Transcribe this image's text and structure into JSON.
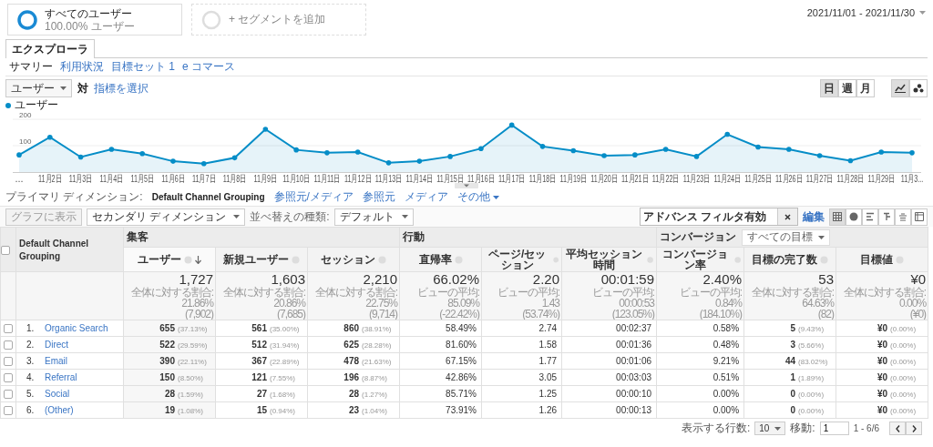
{
  "segments": [
    {
      "kind": "active",
      "title": "すべてのユーザー",
      "subtitle": "100.00% ユーザー"
    },
    {
      "kind": "add",
      "title": "+ セグメントを追加"
    }
  ],
  "date_range": "2021/11/01 - 2021/11/30",
  "tabs": [
    {
      "label": "エクスプローラ",
      "selected": true
    }
  ],
  "subtabs": [
    {
      "label": "サマリー",
      "selected": true
    },
    {
      "label": "利用状況",
      "selected": false
    },
    {
      "label": "目標セット 1",
      "selected": false
    },
    {
      "label": "e コマース",
      "selected": false
    }
  ],
  "metric_selector": {
    "metric": "ユーザー",
    "vs": "対",
    "compare_link": "指標を選択"
  },
  "interval_buttons": [
    {
      "label": "日",
      "selected": true
    },
    {
      "label": "週",
      "selected": false
    },
    {
      "label": "月",
      "selected": false
    }
  ],
  "chart_type_buttons": [
    {
      "kind": "line",
      "selected": true
    },
    {
      "kind": "motion",
      "selected": false
    }
  ],
  "chart": {
    "chart_data": {
      "type": "area",
      "categories": [
        "...",
        "11月2日",
        "11月3日",
        "11月4日",
        "11月5日",
        "11月6日",
        "11月7日",
        "11月8日",
        "11月9日",
        "11月10日",
        "11月11日",
        "11月12日",
        "11月13日",
        "11月14日",
        "11月15日",
        "11月16日",
        "11月17日",
        "11月18日",
        "11月19日",
        "11月20日",
        "11月21日",
        "11月22日",
        "11月23日",
        "11月24日",
        "11月25日",
        "11月26日",
        "11月27日",
        "11月28日",
        "11月29日",
        "11月3..."
      ],
      "series": [
        {
          "name": "ユーザー",
          "color": "#058dc7",
          "values": [
            65,
            132,
            57,
            86,
            70,
            41,
            32,
            54,
            162,
            84,
            73,
            76,
            35,
            41,
            59,
            89,
            178,
            97,
            81,
            62,
            65,
            86,
            59,
            143,
            95,
            86,
            62,
            43,
            76,
            73
          ]
        }
      ],
      "ylim": [
        0,
        200
      ],
      "yticks": [
        100,
        200
      ]
    }
  },
  "primary_dimension": {
    "label": "プライマリ ディメンション:",
    "options": [
      {
        "label": "Default Channel Grouping",
        "kind": "link",
        "selected": true
      },
      {
        "label": "参照元/メディア",
        "kind": "link",
        "selected": false
      },
      {
        "label": "参照元",
        "kind": "link",
        "selected": false
      },
      {
        "label": "メディア",
        "kind": "link",
        "selected": false
      },
      {
        "label": "その他",
        "kind": "menu",
        "selected": false
      }
    ]
  },
  "toolbar": {
    "plot_button": {
      "label": "グラフに表示",
      "disabled": true
    },
    "secondary_dimension": "セカンダリ ディメンション",
    "sort_label": "並べ替えの種類:",
    "sort_value": "デフォルト",
    "filter": "アドバンス フィルタ有効",
    "edit_link": "編集",
    "views": [
      {
        "kind": "table",
        "selected": true
      },
      {
        "kind": "pie",
        "selected": false
      },
      {
        "kind": "performance",
        "selected": false
      },
      {
        "kind": "comparison",
        "selected": false
      },
      {
        "kind": "term-cloud",
        "selected": false
      },
      {
        "kind": "pivot",
        "selected": false
      }
    ]
  },
  "table": {
    "select_all_checked": false,
    "dimension_header": "Default Channel Grouping",
    "groups": [
      {
        "label": "集客",
        "columns": [
          {
            "label": "ユーザー",
            "sorted": true
          },
          {
            "label": "新規ユーザー",
            "sorted": false
          },
          {
            "label": "セッション",
            "sorted": false
          }
        ]
      },
      {
        "label": "行動",
        "columns": [
          {
            "label": "直帰率",
            "sorted": false
          },
          {
            "label": "ページ/セッション",
            "sorted": false
          },
          {
            "label": "平均セッション時間",
            "sorted": false
          }
        ]
      },
      {
        "label": "コンバージョン",
        "goal_selector": "すべての目標",
        "columns": [
          {
            "label": "コンバージョン率",
            "sorted": false
          },
          {
            "label": "目標の完了数",
            "sorted": false
          },
          {
            "label": "目標値",
            "sorted": false
          }
        ]
      }
    ],
    "totals": [
      {
        "value": "1,727",
        "note": "全体に対する割合: 21.86%",
        "base": "(7,902)"
      },
      {
        "value": "1,603",
        "note": "全体に対する割合: 20.86%",
        "base": "(7,685)"
      },
      {
        "value": "2,210",
        "note": "全体に対する割合: 22.75%",
        "base": "(9,714)"
      },
      {
        "value": "66.02%",
        "note": "ビューの平均: 85.09%",
        "base": "(-22.42%)"
      },
      {
        "value": "2.20",
        "note": "ビューの平均: 1.43",
        "base": "(53.74%)"
      },
      {
        "value": "00:01:59",
        "note": "ビューの平均: 00:00:53",
        "base": "(123.05%)"
      },
      {
        "value": "2.40%",
        "note": "ビューの平均: 0.84%",
        "base": "(184.10%)"
      },
      {
        "value": "53",
        "note": "全体に対する割合: 64.63%",
        "base": "(82)"
      },
      {
        "value": "¥0",
        "note": "全体に対する割合: 0.00%",
        "base": "(¥0)"
      }
    ],
    "rows": [
      {
        "index": "1.",
        "name": "Organic Search",
        "checked": false,
        "cells": [
          {
            "value": "655",
            "share": "(37.13%)"
          },
          {
            "value": "561",
            "share": "(35.00%)"
          },
          {
            "value": "860",
            "share": "(38.91%)"
          },
          {
            "value": "58.49%"
          },
          {
            "value": "2.74"
          },
          {
            "value": "00:02:37"
          },
          {
            "value": "0.58%"
          },
          {
            "value": "5",
            "share": "(9.43%)"
          },
          {
            "value": "¥0",
            "share": "(0.00%)"
          }
        ]
      },
      {
        "index": "2.",
        "name": "Direct",
        "checked": false,
        "cells": [
          {
            "value": "522",
            "share": "(29.59%)"
          },
          {
            "value": "512",
            "share": "(31.94%)"
          },
          {
            "value": "625",
            "share": "(28.28%)"
          },
          {
            "value": "81.60%"
          },
          {
            "value": "1.58"
          },
          {
            "value": "00:01:36"
          },
          {
            "value": "0.48%"
          },
          {
            "value": "3",
            "share": "(5.66%)"
          },
          {
            "value": "¥0",
            "share": "(0.00%)"
          }
        ]
      },
      {
        "index": "3.",
        "name": "Email",
        "checked": false,
        "cells": [
          {
            "value": "390",
            "share": "(22.11%)"
          },
          {
            "value": "367",
            "share": "(22.89%)"
          },
          {
            "value": "478",
            "share": "(21.63%)"
          },
          {
            "value": "67.15%"
          },
          {
            "value": "1.77"
          },
          {
            "value": "00:01:06"
          },
          {
            "value": "9.21%"
          },
          {
            "value": "44",
            "share": "(83.02%)"
          },
          {
            "value": "¥0",
            "share": "(0.00%)"
          }
        ]
      },
      {
        "index": "4.",
        "name": "Referral",
        "checked": false,
        "cells": [
          {
            "value": "150",
            "share": "(8.50%)"
          },
          {
            "value": "121",
            "share": "(7.55%)"
          },
          {
            "value": "196",
            "share": "(8.87%)"
          },
          {
            "value": "42.86%"
          },
          {
            "value": "3.05"
          },
          {
            "value": "00:03:03"
          },
          {
            "value": "0.51%"
          },
          {
            "value": "1",
            "share": "(1.89%)"
          },
          {
            "value": "¥0",
            "share": "(0.00%)"
          }
        ]
      },
      {
        "index": "5.",
        "name": "Social",
        "checked": false,
        "cells": [
          {
            "value": "28",
            "share": "(1.59%)"
          },
          {
            "value": "27",
            "share": "(1.68%)"
          },
          {
            "value": "28",
            "share": "(1.27%)"
          },
          {
            "value": "85.71%"
          },
          {
            "value": "1.25"
          },
          {
            "value": "00:00:10"
          },
          {
            "value": "0.00%"
          },
          {
            "value": "0",
            "share": "(0.00%)"
          },
          {
            "value": "¥0",
            "share": "(0.00%)"
          }
        ]
      },
      {
        "index": "6.",
        "name": "(Other)",
        "checked": false,
        "cells": [
          {
            "value": "19",
            "share": "(1.08%)"
          },
          {
            "value": "15",
            "share": "(0.94%)"
          },
          {
            "value": "23",
            "share": "(1.04%)"
          },
          {
            "value": "73.91%"
          },
          {
            "value": "1.26"
          },
          {
            "value": "00:00:13"
          },
          {
            "value": "0.00%"
          },
          {
            "value": "0",
            "share": "(0.00%)"
          },
          {
            "value": "¥0",
            "share": "(0.00%)"
          }
        ]
      }
    ]
  },
  "pager": {
    "rows_label": "表示する行数:",
    "rows_value": "10",
    "goto_label": "移動:",
    "goto_value": "1",
    "range": "1 - 6/6"
  }
}
